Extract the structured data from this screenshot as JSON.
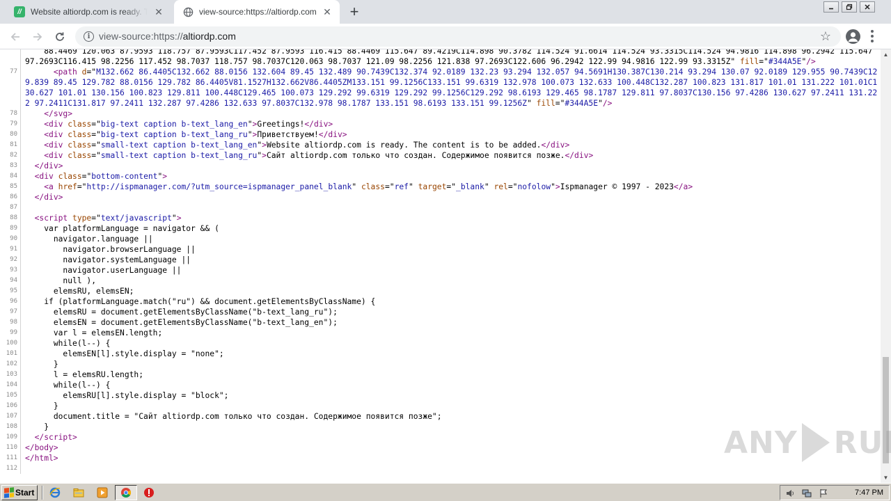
{
  "browser": {
    "tabs": [
      {
        "title": "Website altiordp.com is ready. The c",
        "favicon": "ispmanager-favicon",
        "active": false
      },
      {
        "title": "view-source:https://altiordp.com",
        "favicon": "globe-icon",
        "active": true
      }
    ],
    "address": {
      "prefix": "view-source:https://",
      "host": "altiordp.com"
    }
  },
  "source": {
    "lines": [
      {
        "n": "",
        "html": "    88.4469 120.063 87.9593 118.757 87.9593C117.452 87.9593 116.415 88.4469 115.647 89.4219C114.898 90.3782 114.524 91.6614 114.524 93.3315C114.524 94.9816 114.898 96.2942 115.647 97.2693C116.415 98.2256 117.452 98.7037 118.757 98.7037C120.063 98.7037 121.09 98.2256 121.838 97.2693C122.606 96.2942 122.99 94.9816 122.99 93.3315Z\" <span class=\"attr\">fill</span>=\"<span class=\"val\">#344A5E</span>\"<span class=\"tag\">/&gt;</span>"
      },
      {
        "n": "77",
        "html": "      <span class=\"tag\">&lt;path</span> <span class=\"attr\">d</span>=\"<span class=\"val\">M132.662 86.4405C132.662 88.0156 132.604 89.45 132.489 90.7439C132.374 92.0189 132.23 93.294 132.057 94.5691H130.387C130.214 93.294 130.07 92.0189 129.955 90.7439C129.839 89.45 129.782 88.0156 129.782 86.4405V81.1527H132.662V86.4405ZM133.151 99.1256C133.151 99.6319 132.978 100.073 132.633 100.448C132.287 100.823 131.817 101.01 131.222 101.01C130.627 101.01 130.156 100.823 129.811 100.448C129.465 100.073 129.292 99.6319 129.292 99.1256C129.292 98.6193 129.465 98.1787 129.811 97.8037C130.156 97.4286 130.627 97.2411 131.222 97.2411C131.817 97.2411 132.287 97.4286 132.633 97.8037C132.978 98.1787 133.151 98.6193 133.151 99.1256Z</span>\" <span class=\"attr\">fill</span>=\"<span class=\"val\">#344A5E</span>\"<span class=\"tag\">/&gt;</span>"
      },
      {
        "n": "78",
        "html": "    <span class=\"tag\">&lt;/svg&gt;</span>"
      },
      {
        "n": "79",
        "html": "    <span class=\"tag\">&lt;div</span> <span class=\"attr\">class</span>=\"<span class=\"val\">big-text caption b-text_lang_en</span>\"<span class=\"tag\">&gt;</span>Greetings!<span class=\"tag\">&lt;/div&gt;</span>"
      },
      {
        "n": "80",
        "html": "    <span class=\"tag\">&lt;div</span> <span class=\"attr\">class</span>=\"<span class=\"val\">big-text caption b-text_lang_ru</span>\"<span class=\"tag\">&gt;</span>Приветствуем!<span class=\"tag\">&lt;/div&gt;</span>"
      },
      {
        "n": "81",
        "html": "    <span class=\"tag\">&lt;div</span> <span class=\"attr\">class</span>=\"<span class=\"val\">small-text caption b-text_lang_en</span>\"<span class=\"tag\">&gt;</span>Website altiordp.com is ready. The content is to be added.<span class=\"tag\">&lt;/div&gt;</span>"
      },
      {
        "n": "82",
        "html": "    <span class=\"tag\">&lt;div</span> <span class=\"attr\">class</span>=\"<span class=\"val\">small-text caption b-text_lang_ru</span>\"<span class=\"tag\">&gt;</span>Сайт altiordp.com только что создан. Содержимое появится позже.<span class=\"tag\">&lt;/div&gt;</span>"
      },
      {
        "n": "83",
        "html": "  <span class=\"tag\">&lt;/div&gt;</span>"
      },
      {
        "n": "84",
        "html": "  <span class=\"tag\">&lt;div</span> <span class=\"attr\">class</span>=\"<span class=\"val\">bottom-content</span>\"<span class=\"tag\">&gt;</span>"
      },
      {
        "n": "85",
        "html": "    <span class=\"tag\">&lt;a</span> <span class=\"attr\">href</span>=\"<span class=\"link\">http://ispmanager.com/?utm_source=ispmanager_panel_blank</span>\" <span class=\"attr\">class</span>=\"<span class=\"val\">ref</span>\" <span class=\"attr\">target</span>=\"<span class=\"val\">_blank</span>\" <span class=\"attr\">rel</span>=\"<span class=\"val\">nofolow</span>\"<span class=\"tag\">&gt;</span>Ispmanager © 1997 - 2023<span class=\"tag\">&lt;/a&gt;</span>"
      },
      {
        "n": "86",
        "html": "  <span class=\"tag\">&lt;/div&gt;</span>"
      },
      {
        "n": "87",
        "html": ""
      },
      {
        "n": "88",
        "html": "  <span class=\"tag\">&lt;script</span> <span class=\"attr\">type</span>=\"<span class=\"val\">text/javascript</span>\"<span class=\"tag\">&gt;</span>"
      },
      {
        "n": "89",
        "html": "    var platformLanguage = navigator &amp;&amp; ("
      },
      {
        "n": "90",
        "html": "      navigator.language ||"
      },
      {
        "n": "91",
        "html": "        navigator.browserLanguage ||"
      },
      {
        "n": "92",
        "html": "        navigator.systemLanguage ||"
      },
      {
        "n": "93",
        "html": "        navigator.userLanguage ||"
      },
      {
        "n": "94",
        "html": "        null ),"
      },
      {
        "n": "95",
        "html": "      elemsRU, elemsEN;"
      },
      {
        "n": "96",
        "html": "    if (platformLanguage.match(\"ru\") &amp;&amp; document.getElementsByClassName) {"
      },
      {
        "n": "97",
        "html": "      elemsRU = document.getElementsByClassName(\"b-text_lang_ru\");"
      },
      {
        "n": "98",
        "html": "      elemsEN = document.getElementsByClassName(\"b-text_lang_en\");"
      },
      {
        "n": "99",
        "html": "      var l = elemsEN.length;"
      },
      {
        "n": "100",
        "html": "      while(l--) {"
      },
      {
        "n": "101",
        "html": "        elemsEN[l].style.display = \"none\";"
      },
      {
        "n": "102",
        "html": "      }"
      },
      {
        "n": "103",
        "html": "      l = elemsRU.length;"
      },
      {
        "n": "104",
        "html": "      while(l--) {"
      },
      {
        "n": "105",
        "html": "        elemsRU[l].style.display = \"block\";"
      },
      {
        "n": "106",
        "html": "      }"
      },
      {
        "n": "107",
        "html": "      document.title = \"Сайт altiordp.com только что создан. Содержимое появится позже\";"
      },
      {
        "n": "108",
        "html": "    }"
      },
      {
        "n": "109",
        "html": "  <span class=\"tag\">&lt;/script&gt;</span>"
      },
      {
        "n": "110",
        "html": "<span class=\"tag\">&lt;/body&gt;</span>"
      },
      {
        "n": "111",
        "html": "<span class=\"tag\">&lt;/html&gt;</span>"
      },
      {
        "n": "112",
        "html": ""
      }
    ],
    "scroll_position": 0.97
  },
  "watermark": {
    "left": "ANY",
    "right": "RUN"
  },
  "taskbar": {
    "start_label": "Start",
    "clock": "7:47 PM"
  },
  "colors": {
    "tag": "#881280",
    "attribute": "#994500",
    "value": "#1a1aa6",
    "line_number": "#8a8a8a"
  }
}
